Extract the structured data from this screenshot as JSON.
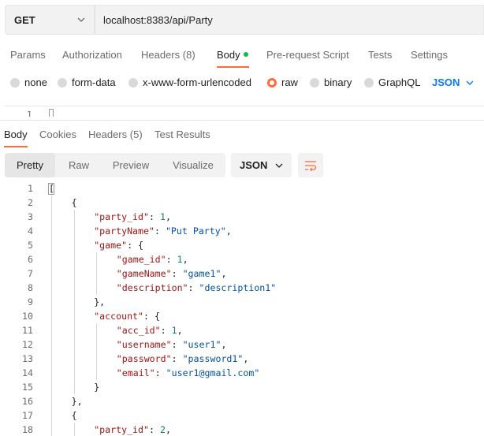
{
  "request": {
    "method": "GET",
    "url": "localhost:8383/api/Party"
  },
  "request_tabs": [
    {
      "label": "Params",
      "active": false
    },
    {
      "label": "Authorization",
      "active": false
    },
    {
      "label": "Headers",
      "count": "(8)",
      "active": false
    },
    {
      "label": "Body",
      "active": true,
      "indicator": "green-dot"
    },
    {
      "label": "Pre-request Script",
      "active": false
    },
    {
      "label": "Tests",
      "active": false
    },
    {
      "label": "Settings",
      "active": false
    }
  ],
  "body_types": [
    {
      "label": "none",
      "selected": false
    },
    {
      "label": "form-data",
      "selected": false
    },
    {
      "label": "x-www-form-urlencoded",
      "selected": false
    },
    {
      "label": "raw",
      "selected": true
    },
    {
      "label": "binary",
      "selected": false
    },
    {
      "label": "GraphQL",
      "selected": false
    }
  ],
  "raw_format": "JSON",
  "request_editor": {
    "line_number": "1"
  },
  "response_tabs": [
    {
      "label": "Body",
      "active": true
    },
    {
      "label": "Cookies",
      "active": false
    },
    {
      "label": "Headers",
      "count": "(5)",
      "active": false
    },
    {
      "label": "Test Results",
      "active": false
    }
  ],
  "view_modes": [
    {
      "label": "Pretty",
      "active": true
    },
    {
      "label": "Raw",
      "active": false
    },
    {
      "label": "Preview",
      "active": false
    },
    {
      "label": "Visualize",
      "active": false
    }
  ],
  "response_format": "JSON",
  "icons": {
    "method_chevron": "chevron-down-icon",
    "format_chevron": "chevron-down-icon",
    "wrap": "wrap-lines-icon"
  },
  "colors": {
    "accent": "#ff6c37",
    "json_link": "#097bed",
    "key": "#a31515",
    "string": "#0451a5",
    "number": "#098658",
    "success_dot": "#0cbb52"
  },
  "code_lines": [
    {
      "num": "1",
      "indent": 0,
      "tokens": [
        [
          "p",
          "["
        ]
      ]
    },
    {
      "num": "2",
      "indent": 1,
      "tokens": [
        [
          "p",
          "{"
        ]
      ]
    },
    {
      "num": "3",
      "indent": 2,
      "tokens": [
        [
          "k",
          "\"party_id\""
        ],
        [
          "p",
          ": "
        ],
        [
          "n",
          "1"
        ],
        [
          "p",
          ","
        ]
      ]
    },
    {
      "num": "4",
      "indent": 2,
      "tokens": [
        [
          "k",
          "\"partyName\""
        ],
        [
          "p",
          ": "
        ],
        [
          "s",
          "\"Put Party\""
        ],
        [
          "p",
          ","
        ]
      ]
    },
    {
      "num": "5",
      "indent": 2,
      "tokens": [
        [
          "k",
          "\"game\""
        ],
        [
          "p",
          ": {"
        ]
      ]
    },
    {
      "num": "6",
      "indent": 3,
      "tokens": [
        [
          "k",
          "\"game_id\""
        ],
        [
          "p",
          ": "
        ],
        [
          "n",
          "1"
        ],
        [
          "p",
          ","
        ]
      ]
    },
    {
      "num": "7",
      "indent": 3,
      "tokens": [
        [
          "k",
          "\"gameName\""
        ],
        [
          "p",
          ": "
        ],
        [
          "s",
          "\"game1\""
        ],
        [
          "p",
          ","
        ]
      ]
    },
    {
      "num": "8",
      "indent": 3,
      "tokens": [
        [
          "k",
          "\"description\""
        ],
        [
          "p",
          ": "
        ],
        [
          "s",
          "\"description1\""
        ]
      ]
    },
    {
      "num": "9",
      "indent": 2,
      "tokens": [
        [
          "p",
          "},"
        ]
      ]
    },
    {
      "num": "10",
      "indent": 2,
      "tokens": [
        [
          "k",
          "\"account\""
        ],
        [
          "p",
          ": {"
        ]
      ]
    },
    {
      "num": "11",
      "indent": 3,
      "tokens": [
        [
          "k",
          "\"acc_id\""
        ],
        [
          "p",
          ": "
        ],
        [
          "n",
          "1"
        ],
        [
          "p",
          ","
        ]
      ]
    },
    {
      "num": "12",
      "indent": 3,
      "tokens": [
        [
          "k",
          "\"username\""
        ],
        [
          "p",
          ": "
        ],
        [
          "s",
          "\"user1\""
        ],
        [
          "p",
          ","
        ]
      ]
    },
    {
      "num": "13",
      "indent": 3,
      "tokens": [
        [
          "k",
          "\"password\""
        ],
        [
          "p",
          ": "
        ],
        [
          "s",
          "\"password1\""
        ],
        [
          "p",
          ","
        ]
      ]
    },
    {
      "num": "14",
      "indent": 3,
      "tokens": [
        [
          "k",
          "\"email\""
        ],
        [
          "p",
          ": "
        ],
        [
          "s",
          "\"user1@gmail.com\""
        ]
      ]
    },
    {
      "num": "15",
      "indent": 2,
      "tokens": [
        [
          "p",
          "}"
        ]
      ]
    },
    {
      "num": "16",
      "indent": 1,
      "tokens": [
        [
          "p",
          "},"
        ]
      ]
    },
    {
      "num": "17",
      "indent": 1,
      "tokens": [
        [
          "p",
          "{"
        ]
      ]
    },
    {
      "num": "18",
      "indent": 2,
      "tokens": [
        [
          "k",
          "\"party_id\""
        ],
        [
          "p",
          ": "
        ],
        [
          "n",
          "2"
        ],
        [
          "p",
          ","
        ]
      ]
    }
  ]
}
